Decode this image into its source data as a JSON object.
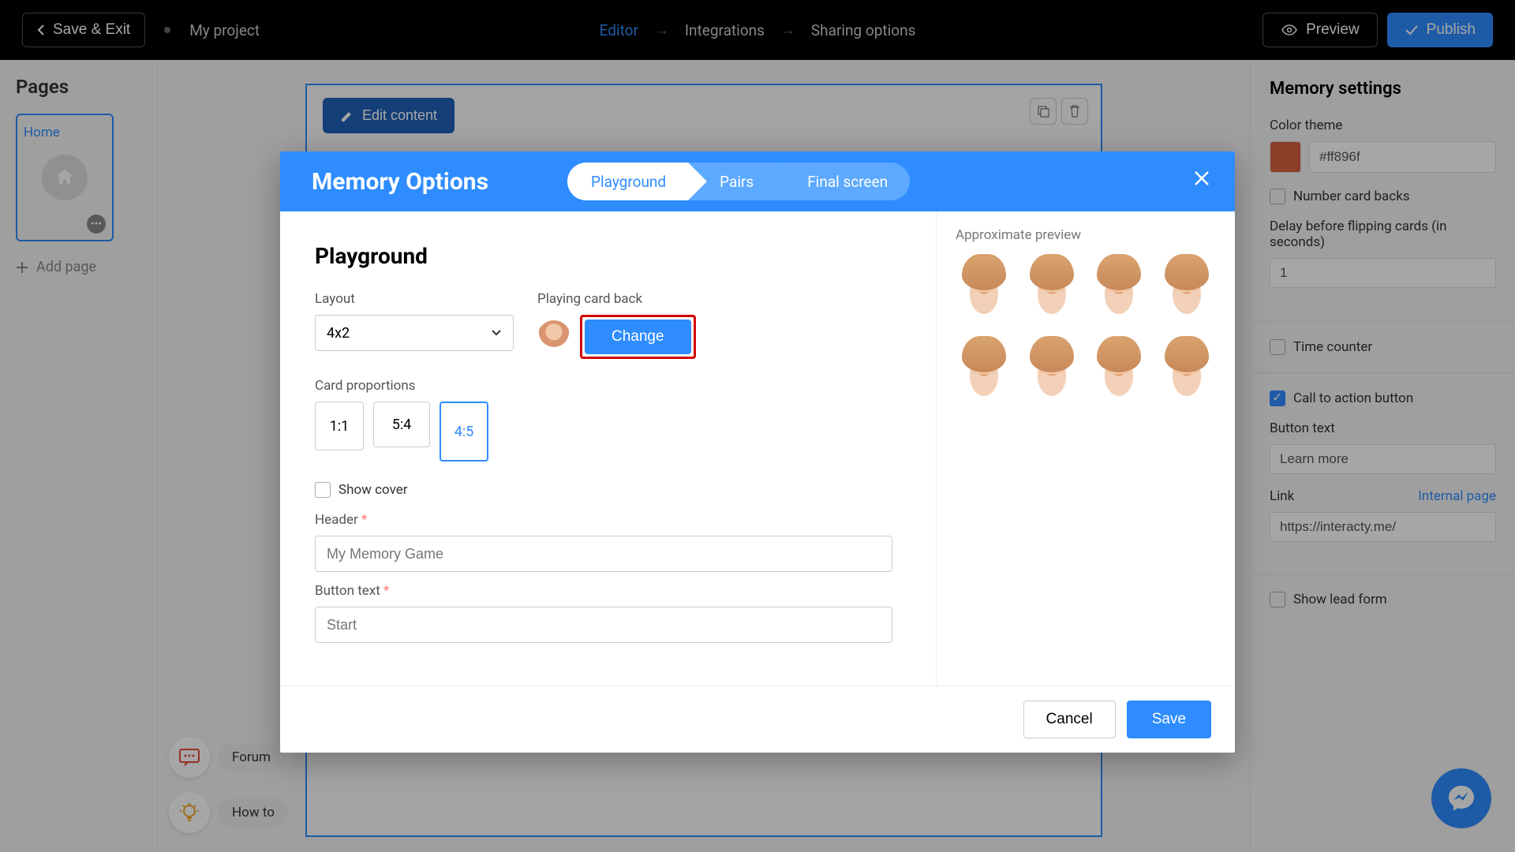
{
  "topbar": {
    "save_exit": "Save & Exit",
    "project_name": "My project",
    "breadcrumbs": [
      "Editor",
      "Integrations",
      "Sharing options"
    ],
    "preview": "Preview",
    "publish": "Publish"
  },
  "left_panel": {
    "title": "Pages",
    "page_label": "Home",
    "add_page": "Add page"
  },
  "canvas": {
    "edit_content": "Edit content"
  },
  "right_panel": {
    "title": "Memory settings",
    "color_theme_label": "Color theme",
    "color_theme_value": "#ff896f",
    "number_backs": "Number card backs",
    "delay_label": "Delay before flipping cards (in seconds)",
    "delay_value": "1",
    "time_counter": "Time counter",
    "cta_button": "Call to action button",
    "button_text_label": "Button text",
    "button_text_value": "Learn more",
    "link_label": "Link",
    "internal_page": "Internal page",
    "link_value": "https://interacty.me/",
    "show_lead_form": "Show lead form"
  },
  "float": {
    "forum": "Forum",
    "howto": "How to"
  },
  "modal": {
    "title": "Memory Options",
    "tabs": [
      "Playground",
      "Pairs",
      "Final screen"
    ],
    "section_title": "Playground",
    "layout_label": "Layout",
    "layout_value": "4x2",
    "cardback_label": "Playing card back",
    "change_label": "Change",
    "proportions_label": "Card proportions",
    "ratios": [
      "1:1",
      "5:4",
      "4:5"
    ],
    "show_cover": "Show cover",
    "header_label": "Header",
    "header_placeholder": "My Memory Game",
    "button_text_label": "Button text",
    "button_text_placeholder": "Start",
    "approx_label": "Approximate preview",
    "cancel": "Cancel",
    "save": "Save"
  }
}
